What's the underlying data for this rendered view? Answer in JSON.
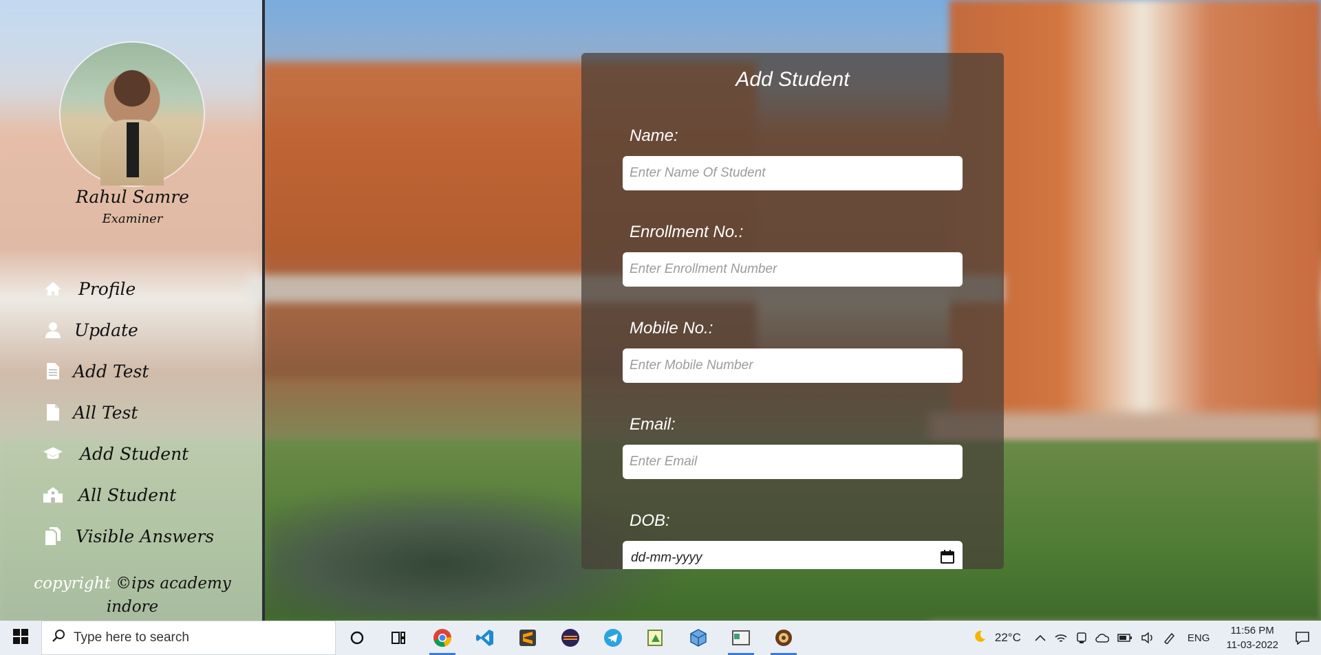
{
  "sidebar": {
    "user_name": "Rahul Samre",
    "user_role": "Examiner",
    "items": [
      {
        "label": "Profile",
        "icon": "home-icon"
      },
      {
        "label": "Update",
        "icon": "user-icon"
      },
      {
        "label": "Add Test",
        "icon": "document-icon"
      },
      {
        "label": "All Test",
        "icon": "file-icon"
      },
      {
        "label": "Add Student",
        "icon": "graduation-cap-icon"
      },
      {
        "label": "All Student",
        "icon": "school-icon"
      },
      {
        "label": "Visible Answers",
        "icon": "copy-icon"
      }
    ],
    "copyright_prefix": "copyright",
    "copyright_text": "©ips academy indore"
  },
  "form": {
    "title": "Add Student",
    "name_label": "Name:",
    "name_placeholder": "Enter Name Of Student",
    "enrollment_label": "Enrollment No.:",
    "enrollment_placeholder": "Enter Enrollment Number",
    "mobile_label": "Mobile No.:",
    "mobile_placeholder": "Enter Mobile Number",
    "email_label": "Email:",
    "email_placeholder": "Enter Email",
    "dob_label": "DOB:",
    "dob_value": "dd-mm-yyyy"
  },
  "taskbar": {
    "search_placeholder": "Type here to search",
    "apps": [
      "cortana-icon",
      "task-view-icon",
      "chrome-icon",
      "vscode-icon",
      "sublime-icon",
      "eclipse-icon",
      "telegram-icon",
      "editor-icon",
      "box-icon",
      "window-icon",
      "app-icon"
    ],
    "weather": "22°C",
    "language": "ENG",
    "time": "11:56 PM",
    "date": "11-03-2022"
  },
  "colors": {
    "panel": "#463e38",
    "accent": "#3b7bd8"
  }
}
